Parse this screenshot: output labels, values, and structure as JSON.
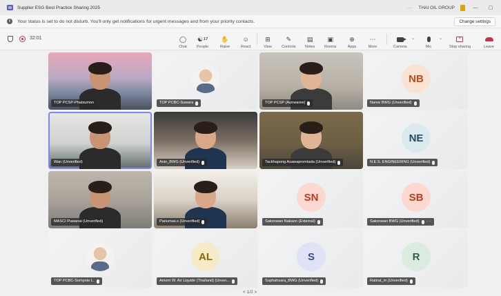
{
  "window": {
    "title": "Supplier ESG Best Practice Sharing 2025",
    "org": "THAI OIL GROUP",
    "more": "···",
    "minimize": "—",
    "restore": "▢"
  },
  "notification": {
    "text": "Your status is set to do not disturb. You'll only get notifications for urgent messages and from your priority contacts.",
    "button": "Change settings"
  },
  "meeting": {
    "timer": "32:01",
    "people_count": "17",
    "controls": {
      "chat": "Chat",
      "people": "People",
      "raise": "Raise",
      "react": "React",
      "view": "View",
      "controls": "Controls",
      "notes": "Notes",
      "rooms": "Rooms",
      "apps": "Apps",
      "more": "More",
      "camera": "Camera",
      "mic": "Mic",
      "stop_sharing": "Stop sharing",
      "leave": "Leave"
    }
  },
  "tiles": [
    {
      "name": "TOP PCSP-Phatsumon",
      "type": "video"
    },
    {
      "name": "TOP PCBC-Suwara",
      "type": "photo",
      "muted": true
    },
    {
      "name": "TOP PCSP (Aunwaree)",
      "type": "video",
      "muted": true
    },
    {
      "name": "Naree BWG (Unverified)",
      "type": "initials",
      "initials": "NB",
      "muted": true,
      "bg": "#fbe3d3",
      "fg": "#c04a1a"
    },
    {
      "name": "Wan (Unverified)",
      "type": "video"
    },
    {
      "name": "Anin_BWG (Unverified)",
      "type": "video",
      "muted": true
    },
    {
      "name": "Tackhapong Asawapromtada (Unverified)",
      "type": "video",
      "muted": true
    },
    {
      "name": "N.E.S. ENGINEERING (Unverified)",
      "type": "initials",
      "initials": "NE",
      "muted": true,
      "bg": "#dbe9ee",
      "fg": "#1f4d5f"
    },
    {
      "name": "MASCI Puwanai (Unverified)",
      "type": "video"
    },
    {
      "name": "Panumas.s (Unverified)",
      "type": "video",
      "muted": true
    },
    {
      "name": "Sakonwan Nakaon (External)",
      "type": "initials",
      "initials": "SN",
      "muted": true,
      "bg": "#fbd9d0",
      "fg": "#c0391a"
    },
    {
      "name": "Sakonwan BWG (Unverified)",
      "type": "initials",
      "initials": "SB",
      "muted": true,
      "bg": "#fbd9d0",
      "fg": "#c0391a",
      "more": "···"
    },
    {
      "name": "TOP PCBC-Somyote L.",
      "type": "photo",
      "muted": true
    },
    {
      "name": "Amorn W. Air Liquide (Thailand) (Unver...",
      "type": "initials",
      "initials": "AL",
      "muted": true,
      "bg": "#f5ebc6",
      "fg": "#8a6a00"
    },
    {
      "name": "Suphahsara_BWG (Unverified)",
      "type": "initials",
      "initials": "S",
      "muted": true,
      "bg": "#dfe3f5",
      "fg": "#3b4a8c"
    },
    {
      "name": "Ratirat_m (Unverified)",
      "type": "initials",
      "initials": "R",
      "muted": true,
      "bg": "#dcebe0",
      "fg": "#2f5e3c"
    }
  ],
  "pager": "< 1/2 >"
}
